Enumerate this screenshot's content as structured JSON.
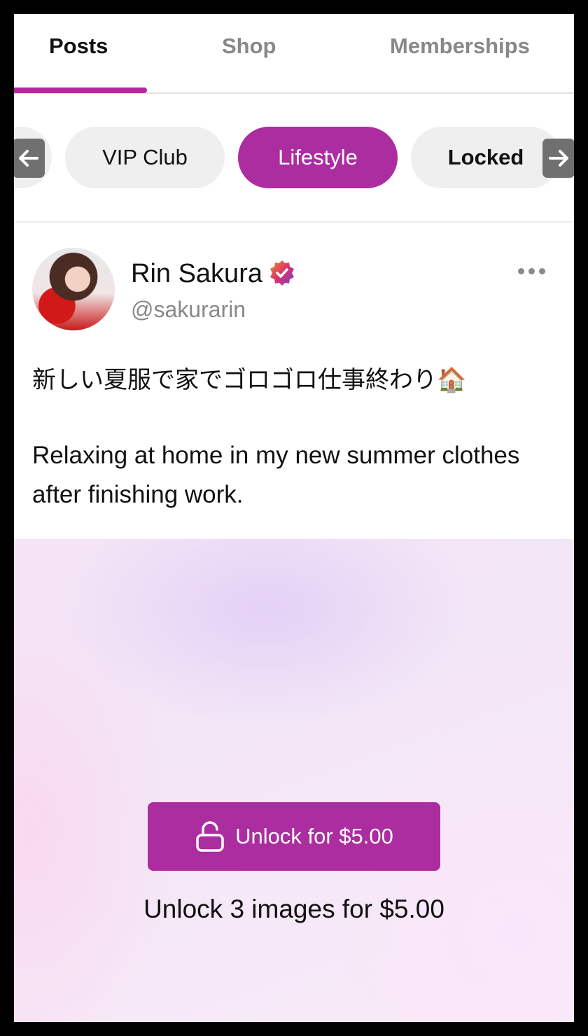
{
  "tabs": [
    {
      "label": "Posts",
      "active": true
    },
    {
      "label": "Shop",
      "active": false
    },
    {
      "label": "Memberships",
      "active": false
    }
  ],
  "categories": {
    "items": [
      "VIP Club",
      "Lifestyle",
      "Locked"
    ],
    "selected": "Lifestyle"
  },
  "post": {
    "author_name": "Rin Sakura",
    "handle": "@sakurarin",
    "verified": true,
    "text_jp": "新しい夏服で家でゴロゴロ仕事終わり🏠",
    "text_en": "Relaxing at home in my new summer clothes after finishing work.",
    "unlock_button_label": "Unlock for $5.00",
    "unlock_caption": "Unlock 3 images for $5.00"
  },
  "colors": {
    "accent": "#ab2d9f",
    "verified_badge": "#e0592a"
  },
  "icons": [
    "arrow-left-icon",
    "arrow-right-icon",
    "verified-badge-icon",
    "more-options-icon",
    "lock-open-icon"
  ]
}
